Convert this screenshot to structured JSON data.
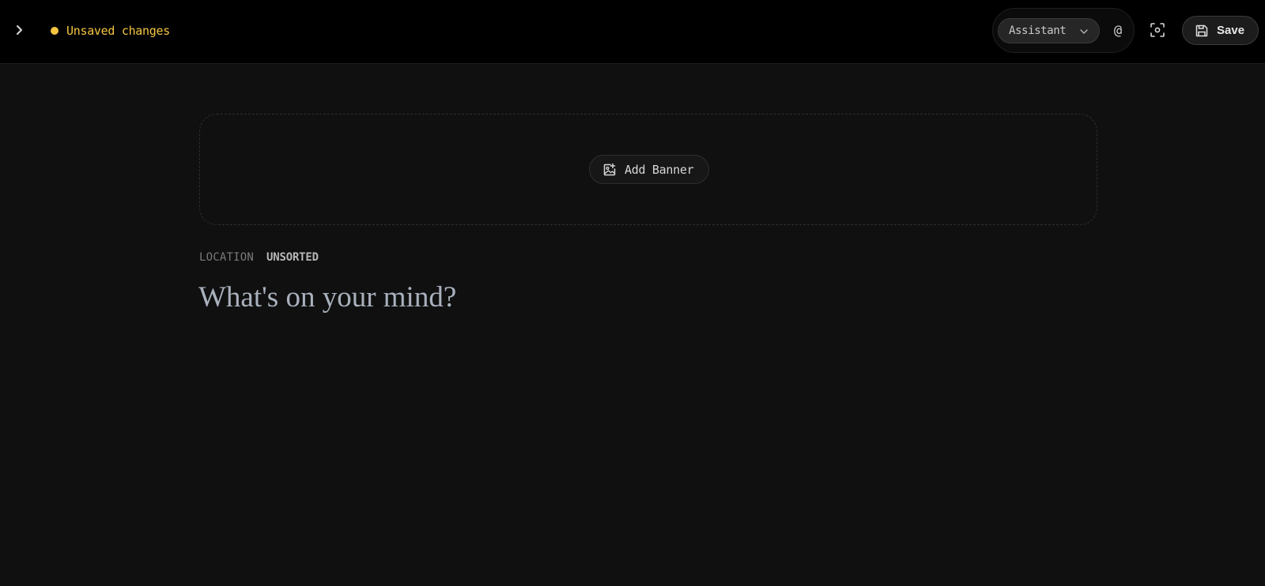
{
  "status": {
    "unsaved_text": "Unsaved changes",
    "dot_color": "#f5c542"
  },
  "toolbar": {
    "assistant_select": "Assistant",
    "mention_label": "@",
    "save_label": "Save"
  },
  "banner": {
    "add_label": "Add Banner"
  },
  "location": {
    "label": "LOCATION",
    "value": "UNSORTED"
  },
  "editor": {
    "title_placeholder": "What's on your mind?"
  },
  "colors": {
    "background": "#101010",
    "topbar": "#000000",
    "accent_warning": "#f5c542"
  },
  "icons": {
    "sidebar_toggle": "chevron-right-icon",
    "assistant_dropdown": "chevron-down-icon",
    "focus": "focus-frame-icon",
    "save": "floppy-disk-icon",
    "add_banner": "image-plus-icon"
  }
}
